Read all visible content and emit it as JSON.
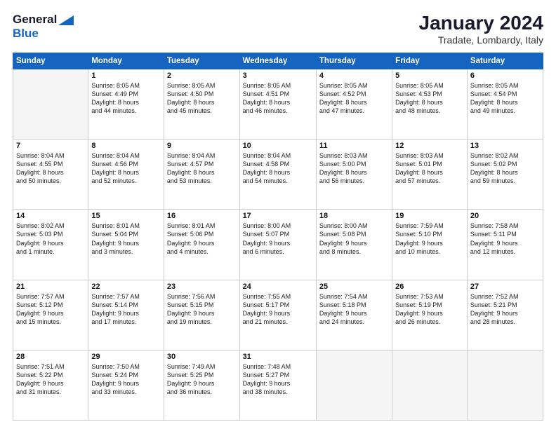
{
  "logo": {
    "general": "General",
    "blue": "Blue"
  },
  "header": {
    "month": "January 2024",
    "location": "Tradate, Lombardy, Italy"
  },
  "weekdays": [
    "Sunday",
    "Monday",
    "Tuesday",
    "Wednesday",
    "Thursday",
    "Friday",
    "Saturday"
  ],
  "weeks": [
    [
      {
        "day": null,
        "text": null
      },
      {
        "day": "1",
        "text": "Sunrise: 8:05 AM\nSunset: 4:49 PM\nDaylight: 8 hours\nand 44 minutes."
      },
      {
        "day": "2",
        "text": "Sunrise: 8:05 AM\nSunset: 4:50 PM\nDaylight: 8 hours\nand 45 minutes."
      },
      {
        "day": "3",
        "text": "Sunrise: 8:05 AM\nSunset: 4:51 PM\nDaylight: 8 hours\nand 46 minutes."
      },
      {
        "day": "4",
        "text": "Sunrise: 8:05 AM\nSunset: 4:52 PM\nDaylight: 8 hours\nand 47 minutes."
      },
      {
        "day": "5",
        "text": "Sunrise: 8:05 AM\nSunset: 4:53 PM\nDaylight: 8 hours\nand 48 minutes."
      },
      {
        "day": "6",
        "text": "Sunrise: 8:05 AM\nSunset: 4:54 PM\nDaylight: 8 hours\nand 49 minutes."
      }
    ],
    [
      {
        "day": "7",
        "text": "Sunrise: 8:04 AM\nSunset: 4:55 PM\nDaylight: 8 hours\nand 50 minutes."
      },
      {
        "day": "8",
        "text": "Sunrise: 8:04 AM\nSunset: 4:56 PM\nDaylight: 8 hours\nand 52 minutes."
      },
      {
        "day": "9",
        "text": "Sunrise: 8:04 AM\nSunset: 4:57 PM\nDaylight: 8 hours\nand 53 minutes."
      },
      {
        "day": "10",
        "text": "Sunrise: 8:04 AM\nSunset: 4:58 PM\nDaylight: 8 hours\nand 54 minutes."
      },
      {
        "day": "11",
        "text": "Sunrise: 8:03 AM\nSunset: 5:00 PM\nDaylight: 8 hours\nand 56 minutes."
      },
      {
        "day": "12",
        "text": "Sunrise: 8:03 AM\nSunset: 5:01 PM\nDaylight: 8 hours\nand 57 minutes."
      },
      {
        "day": "13",
        "text": "Sunrise: 8:02 AM\nSunset: 5:02 PM\nDaylight: 8 hours\nand 59 minutes."
      }
    ],
    [
      {
        "day": "14",
        "text": "Sunrise: 8:02 AM\nSunset: 5:03 PM\nDaylight: 9 hours\nand 1 minute."
      },
      {
        "day": "15",
        "text": "Sunrise: 8:01 AM\nSunset: 5:04 PM\nDaylight: 9 hours\nand 3 minutes."
      },
      {
        "day": "16",
        "text": "Sunrise: 8:01 AM\nSunset: 5:06 PM\nDaylight: 9 hours\nand 4 minutes."
      },
      {
        "day": "17",
        "text": "Sunrise: 8:00 AM\nSunset: 5:07 PM\nDaylight: 9 hours\nand 6 minutes."
      },
      {
        "day": "18",
        "text": "Sunrise: 8:00 AM\nSunset: 5:08 PM\nDaylight: 9 hours\nand 8 minutes."
      },
      {
        "day": "19",
        "text": "Sunrise: 7:59 AM\nSunset: 5:10 PM\nDaylight: 9 hours\nand 10 minutes."
      },
      {
        "day": "20",
        "text": "Sunrise: 7:58 AM\nSunset: 5:11 PM\nDaylight: 9 hours\nand 12 minutes."
      }
    ],
    [
      {
        "day": "21",
        "text": "Sunrise: 7:57 AM\nSunset: 5:12 PM\nDaylight: 9 hours\nand 15 minutes."
      },
      {
        "day": "22",
        "text": "Sunrise: 7:57 AM\nSunset: 5:14 PM\nDaylight: 9 hours\nand 17 minutes."
      },
      {
        "day": "23",
        "text": "Sunrise: 7:56 AM\nSunset: 5:15 PM\nDaylight: 9 hours\nand 19 minutes."
      },
      {
        "day": "24",
        "text": "Sunrise: 7:55 AM\nSunset: 5:17 PM\nDaylight: 9 hours\nand 21 minutes."
      },
      {
        "day": "25",
        "text": "Sunrise: 7:54 AM\nSunset: 5:18 PM\nDaylight: 9 hours\nand 24 minutes."
      },
      {
        "day": "26",
        "text": "Sunrise: 7:53 AM\nSunset: 5:19 PM\nDaylight: 9 hours\nand 26 minutes."
      },
      {
        "day": "27",
        "text": "Sunrise: 7:52 AM\nSunset: 5:21 PM\nDaylight: 9 hours\nand 28 minutes."
      }
    ],
    [
      {
        "day": "28",
        "text": "Sunrise: 7:51 AM\nSunset: 5:22 PM\nDaylight: 9 hours\nand 31 minutes."
      },
      {
        "day": "29",
        "text": "Sunrise: 7:50 AM\nSunset: 5:24 PM\nDaylight: 9 hours\nand 33 minutes."
      },
      {
        "day": "30",
        "text": "Sunrise: 7:49 AM\nSunset: 5:25 PM\nDaylight: 9 hours\nand 36 minutes."
      },
      {
        "day": "31",
        "text": "Sunrise: 7:48 AM\nSunset: 5:27 PM\nDaylight: 9 hours\nand 38 minutes."
      },
      {
        "day": null,
        "text": null
      },
      {
        "day": null,
        "text": null
      },
      {
        "day": null,
        "text": null
      }
    ]
  ]
}
